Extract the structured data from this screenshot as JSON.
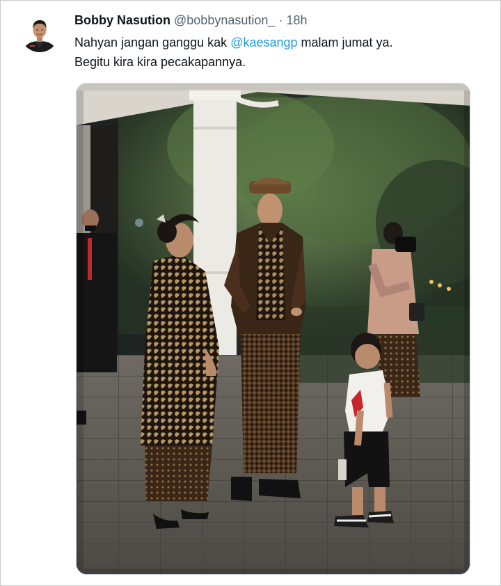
{
  "tweet": {
    "display_name": "Bobby Nasution",
    "handle": "@bobbynasution_",
    "separator": "·",
    "time": "18h",
    "text_before_mention": "Nahyan jangan ganggu kak ",
    "mention": "@kaesangp",
    "text_after_mention": " malam jumat ya.",
    "text_line2": "Begitu kira kira pecakapannya."
  },
  "colors": {
    "mention": "#1d9bf0",
    "text": "#0f1419",
    "secondary": "#536471"
  }
}
